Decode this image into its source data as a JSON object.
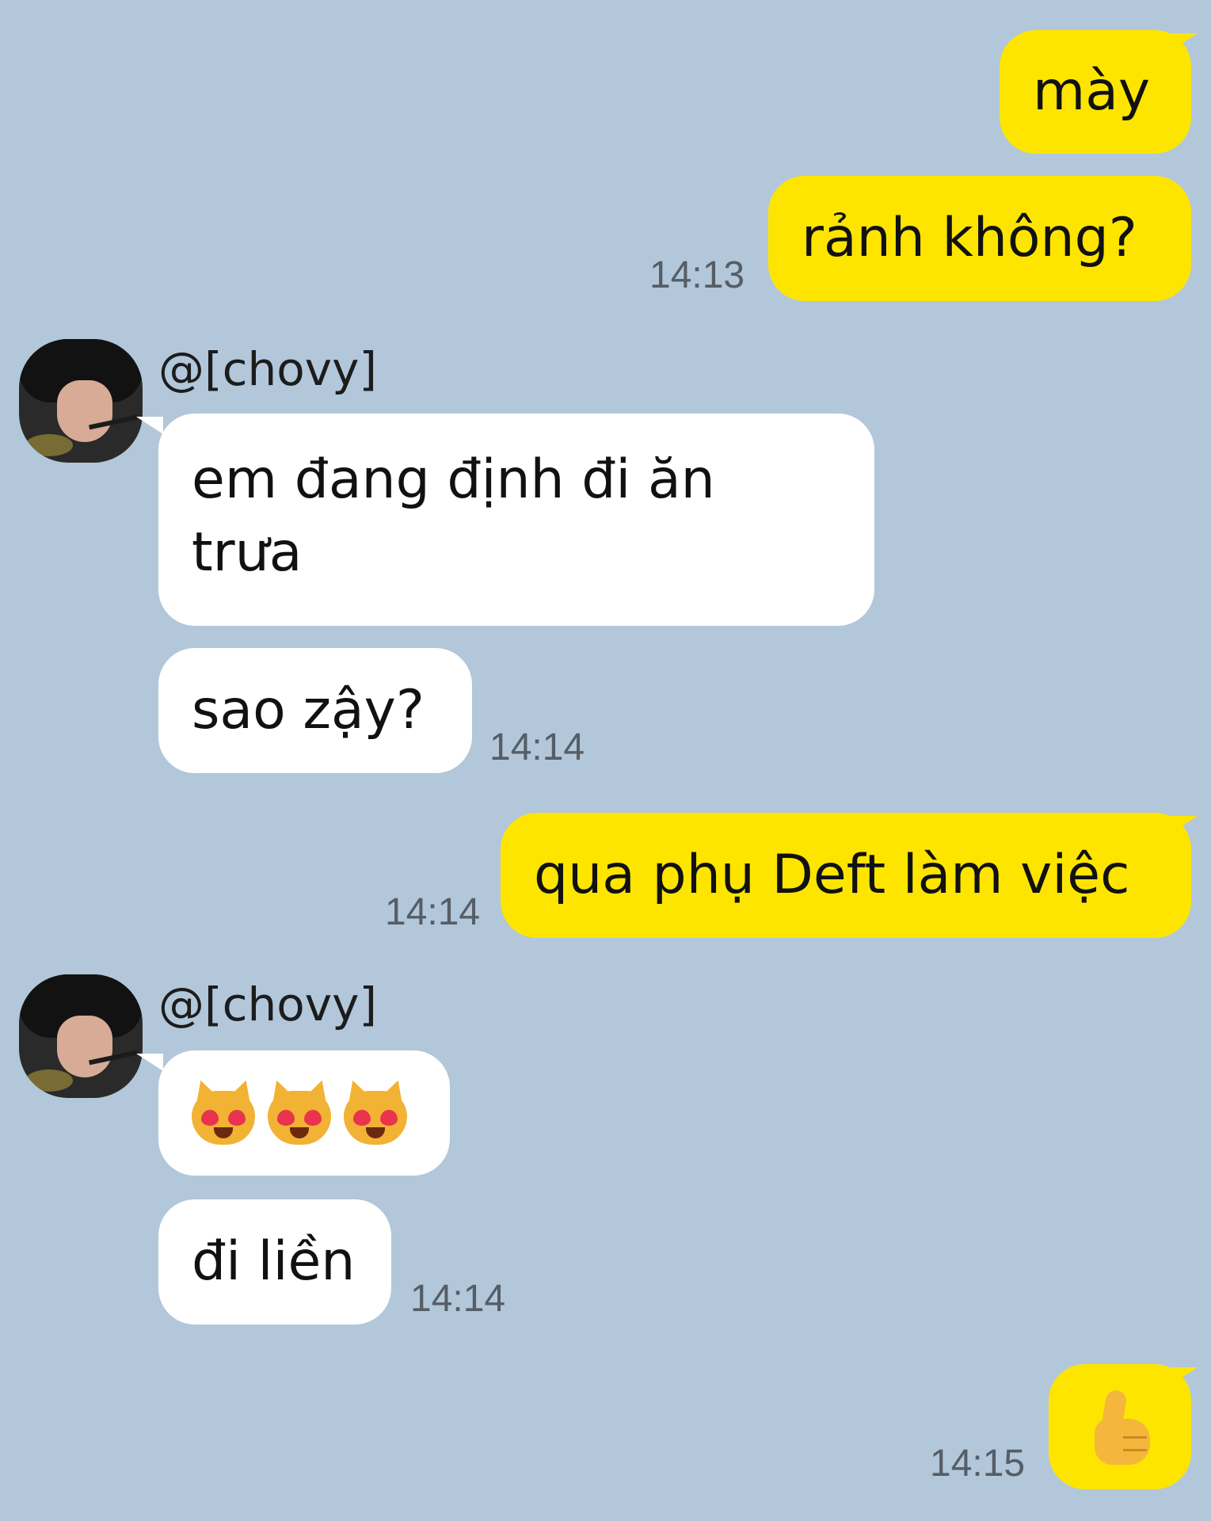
{
  "messages": [
    {
      "sender": "me",
      "text": "mày"
    },
    {
      "sender": "me",
      "text": "rảnh không?",
      "time": "14:13"
    },
    {
      "sender": "them",
      "name": "@[chovy]",
      "text": "em đang định đi ăn trưa"
    },
    {
      "sender": "them",
      "text": "sao zậy?",
      "time": "14:14"
    },
    {
      "sender": "me",
      "text": "qua phụ Deft làm việc",
      "time": "14:14"
    },
    {
      "sender": "them",
      "name": "@[chovy]",
      "emoji": [
        "smiling-cat-heart-eyes",
        "smiling-cat-heart-eyes",
        "smiling-cat-heart-eyes"
      ]
    },
    {
      "sender": "them",
      "text": "đi liền",
      "time": "14:14"
    },
    {
      "sender": "me",
      "emoji": [
        "thumbs-up"
      ],
      "time": "14:15"
    }
  ],
  "colors": {
    "background": "#b2c7da",
    "my_bubble": "#fee500",
    "their_bubble": "#ffffff",
    "timestamp": "#555d66"
  }
}
